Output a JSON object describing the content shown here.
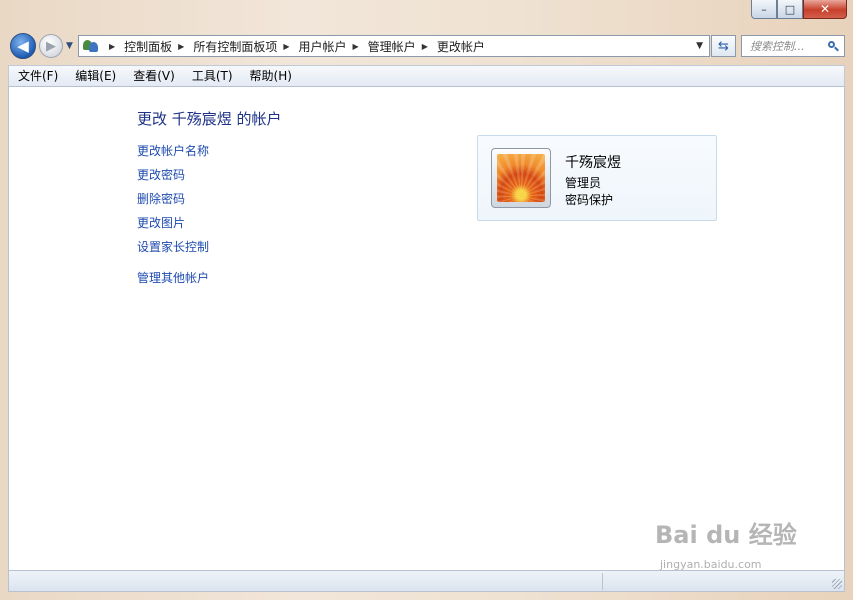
{
  "window": {
    "minimize_glyph": "–",
    "maximize_glyph": "□",
    "close_glyph": "✕"
  },
  "nav": {
    "back_icon": "back-arrow-icon",
    "forward_icon": "forward-arrow-icon",
    "breadcrumb": [
      "控制面板",
      "所有控制面板项",
      "用户帐户",
      "管理帐户",
      "更改帐户"
    ],
    "search_placeholder": "搜索控制..."
  },
  "menu": [
    "文件(F)",
    "编辑(E)",
    "查看(V)",
    "工具(T)",
    "帮助(H)"
  ],
  "main": {
    "title": "更改 千殇宸煜 的帐户",
    "links": [
      "更改帐户名称",
      "更改密码",
      "删除密码",
      "更改图片",
      "设置家长控制"
    ],
    "other_link": "管理其他帐户"
  },
  "account": {
    "name": "千殇宸煜",
    "role": "管理员",
    "status": "密码保护"
  },
  "watermark": {
    "brand": "Bai du 经验",
    "url": "jingyan.baidu.com"
  },
  "colors": {
    "link": "#1e4bb0",
    "title": "#1e3287"
  }
}
